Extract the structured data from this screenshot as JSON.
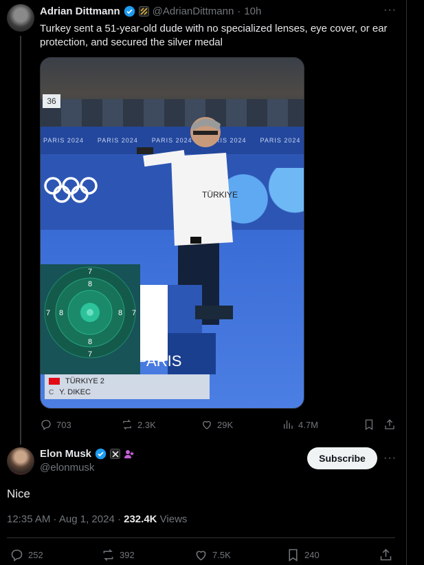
{
  "tweet": {
    "author_name": "Adrian Dittmann",
    "author_handle": "@AdrianDittmann",
    "time": "10h",
    "separator": "·",
    "text": "Turkey sent a 51-year-old dude with no specialized lenses, eye cover, or ear protection, and secured the silver medal",
    "stats": {
      "replies": "703",
      "reposts": "2.3K",
      "likes": "29K",
      "views": "4.7M"
    },
    "media": {
      "lane_number": "36",
      "banner_text": "PARIS 2024",
      "team_label": "TÜRKIYE 2",
      "athlete_label": "Y. DIKEC",
      "watermark": "PARIS",
      "target_numbers": [
        "7",
        "8",
        "7",
        "8",
        "8",
        "7",
        "8",
        "7"
      ]
    }
  },
  "reply": {
    "author_name": "Elon Musk",
    "author_handle": "@elonmusk",
    "subscribe_label": "Subscribe",
    "text": "Nice",
    "timestamp": "12:35 AM · Aug 1, 2024 · ",
    "views_count": "232.4K",
    "views_label": " Views",
    "stats": {
      "replies": "252",
      "reposts": "392",
      "likes": "7.5K",
      "bookmarks": "240"
    }
  },
  "colors": {
    "background": "#000000",
    "text": "#e7e9ea",
    "muted": "#71767b",
    "verified_blue": "#1d9bf0",
    "subscribe_bg": "#eff3f4"
  },
  "icons": [
    "reply-icon",
    "repost-icon",
    "like-icon",
    "views-icon",
    "bookmark-icon",
    "share-icon",
    "verified-icon",
    "more-icon"
  ]
}
